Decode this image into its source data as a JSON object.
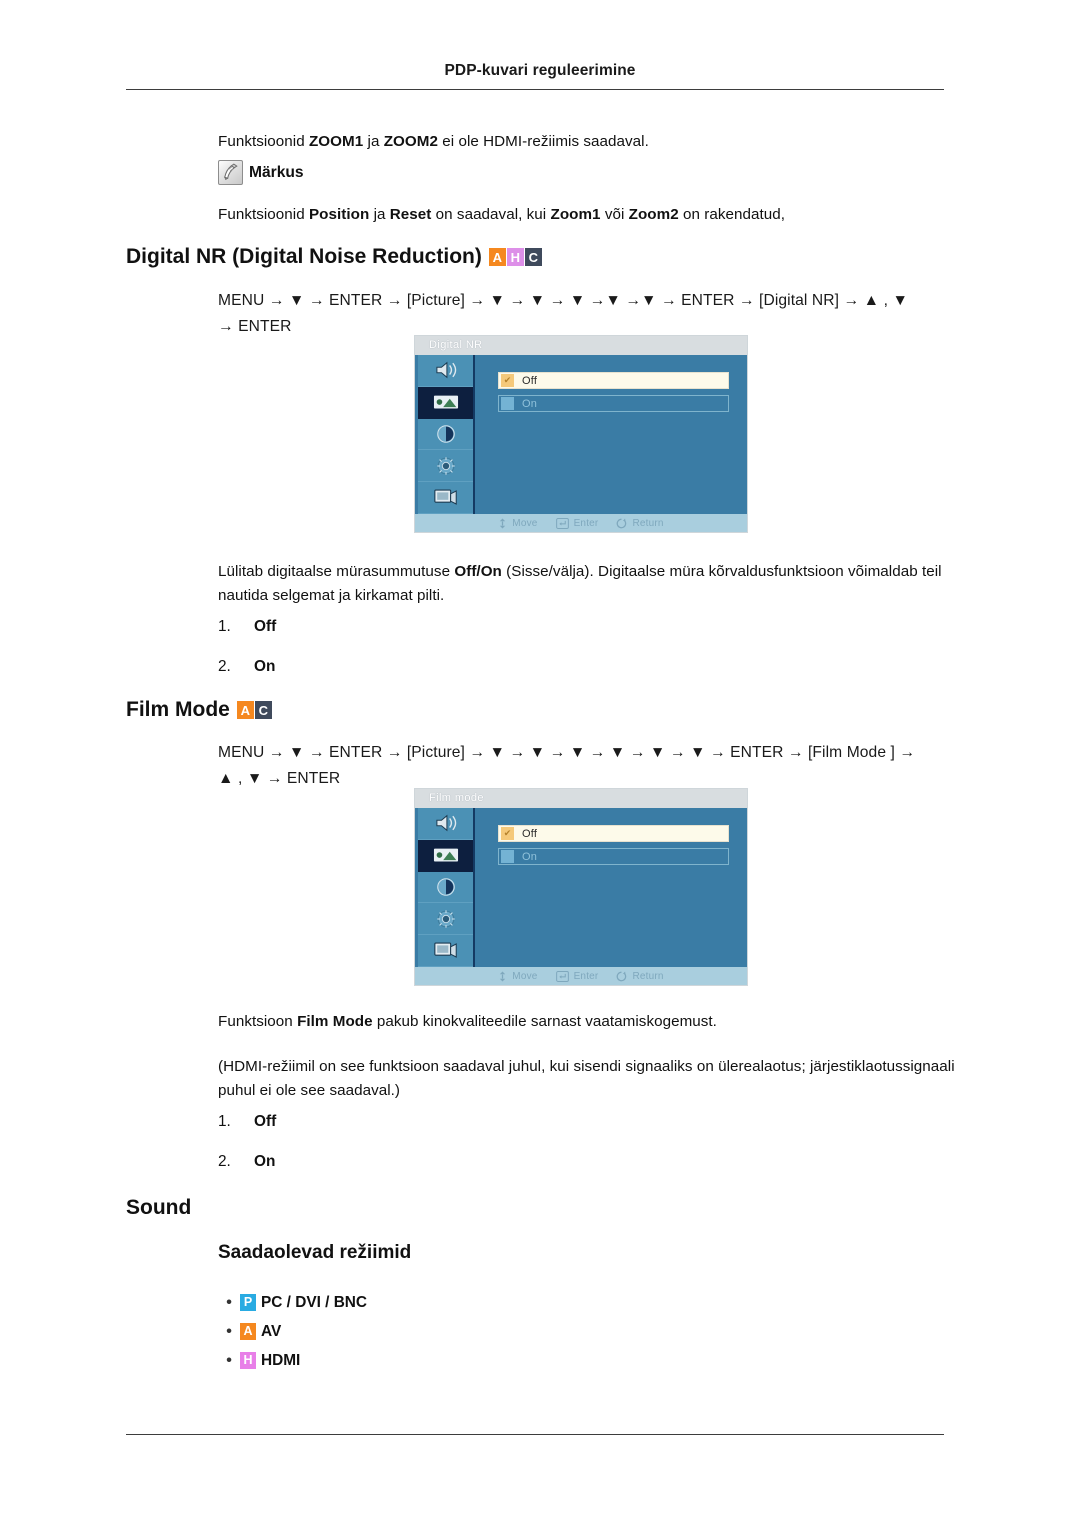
{
  "header": {
    "title": "PDP-kuvari reguleerimine"
  },
  "note": {
    "intro_prefix": "Funktsioonid ",
    "intro_b1": "ZOOM1",
    "intro_mid": " ja ",
    "intro_b2": "ZOOM2",
    "intro_suffix": " ei ole HDMI-režiimis saadaval.",
    "icon": "note-pencil-icon",
    "label": "Märkus",
    "body_prefix": "Funktsioonid ",
    "body_b1": "Position",
    "body_mid1": " ja ",
    "body_b2": "Reset",
    "body_mid2": " on saadaval, kui ",
    "body_b3": "Zoom1",
    "body_mid3": " või ",
    "body_b4": "Zoom2",
    "body_suffix": " on rakendatud,"
  },
  "badge_colors": {
    "A": "#f5881f",
    "H": "#dd8fe8",
    "C": "#3f4a5c",
    "P": "#29abe2",
    "H_sound": "#e87fe8"
  },
  "sections": [
    {
      "id": "digital-nr",
      "heading": "Digital NR (Digital Noise Reduction)",
      "badges": [
        "A",
        "H",
        "C"
      ],
      "menu_path_line1": "MENU → ▼ → ENTER → [Picture] → ▼ → ▼ → ▼ →▼ →▼ → ENTER → [Digital NR] → ▲ , ▼",
      "menu_path_line2": "→ ENTER",
      "osd": {
        "title": "Digital NR",
        "options": [
          {
            "label": "Off",
            "selected": true
          },
          {
            "label": "On",
            "selected": false
          }
        ],
        "hints": [
          {
            "icon": "move-icon",
            "label": "Move"
          },
          {
            "icon": "enter-icon",
            "label": "Enter"
          },
          {
            "icon": "return-icon",
            "label": "Return"
          }
        ]
      },
      "desc_prefix": "Lülitab digitaalse mürasummutuse ",
      "desc_bold": "Off/On",
      "desc_suffix": " (Sisse/välja). Digitaalse müra kõrvaldusfunktsioon võimaldab teil nautida selgemat ja kirkamat pilti.",
      "items": [
        {
          "num": "1.",
          "text": "Off"
        },
        {
          "num": "2.",
          "text": "On"
        }
      ]
    },
    {
      "id": "film-mode",
      "heading": "Film Mode",
      "badges": [
        "A",
        "C"
      ],
      "menu_path_line1": "MENU → ▼ → ENTER → [Picture] → ▼ → ▼ → ▼ → ▼ → ▼ → ▼ → ENTER → [Film Mode ] →",
      "menu_path_line2": "▲ , ▼ → ENTER",
      "osd": {
        "title": "Film mode",
        "options": [
          {
            "label": "Off",
            "selected": true
          },
          {
            "label": "On",
            "selected": false
          }
        ],
        "hints": [
          {
            "icon": "move-icon",
            "label": "Move"
          },
          {
            "icon": "enter-icon",
            "label": "Enter"
          },
          {
            "icon": "return-icon",
            "label": "Return"
          }
        ]
      },
      "desc1_prefix": "Funktsioon ",
      "desc1_bold": "Film Mode",
      "desc1_suffix": " pakub kinokvaliteedile sarnast vaatamiskogemust.",
      "desc2": "(HDMI-režiimil on see funktsioon saadaval juhul, kui sisendi signaaliks on ülerealaotus; järjestiklaotussignaali puhul ei ole see saadaval.)",
      "items": [
        {
          "num": "1.",
          "text": "Off"
        },
        {
          "num": "2.",
          "text": "On"
        }
      ]
    }
  ],
  "sound": {
    "heading": "Sound",
    "subheading": "Saadaolevad režiimid",
    "modes": [
      {
        "badge": "P",
        "badge_color": "#29abe2",
        "label": "PC / DVI / BNC"
      },
      {
        "badge": "A",
        "badge_color": "#f5881f",
        "label": "AV"
      },
      {
        "badge": "H",
        "badge_color": "#e87fe8",
        "label": "HDMI"
      }
    ]
  }
}
